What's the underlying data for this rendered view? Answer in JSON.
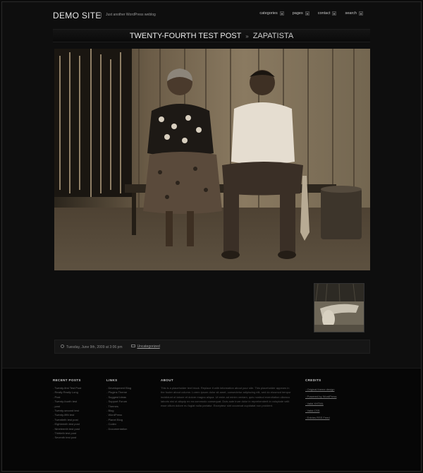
{
  "header": {
    "site_title": "DEMO SITE",
    "tagline": "Just another WordPress weblog",
    "nav": [
      {
        "label": "categories"
      },
      {
        "label": "pages"
      },
      {
        "label": "contact"
      },
      {
        "label": "search"
      }
    ]
  },
  "post": {
    "title": "TWENTY-FOURTH TEST POST",
    "separator": "»",
    "category": "ZAPATISTA",
    "date": "Tuesday, June 9th, 2009 at 3:06 pm",
    "category_link": "Uncategorized"
  },
  "footer": {
    "recent_posts": {
      "heading": "RECENT POSTS",
      "items": [
        "Twenty-first Test Post",
        "Really Really Long",
        "Post",
        "Twenty-fourth test",
        "post",
        "Twenty-second test",
        "Twenty-fifth test",
        "Twentieth test post",
        "Eighteenth test post",
        "Nineteenth test post",
        "Thirtieth test post",
        "Seventh test post"
      ]
    },
    "links": {
      "heading": "LINKS",
      "items": [
        "Development Blog",
        "Plugins Theme",
        "Suggest Ideas",
        "Support Forum",
        "Themes",
        "Blog",
        "WordPress",
        "Planet Blog",
        "Codex",
        "Documentation"
      ]
    },
    "about": {
      "heading": "ABOUT",
      "text": "This is a placeholder text block. Replace it with information about your site. This placeholder appears in the footer about column. Lorem ipsum dolor sit amet, consectetur adipiscing elit, sed do eiusmod tempor incididunt ut labore et dolore magna aliqua. Ut enim ad minim veniam, quis nostrud exercitation ullamco laboris nisi ut aliquip ex ea commodo consequat. Duis aute irure dolor in reprehenderit in voluptate velit esse cillum dolore eu fugiat nulla pariatur. Excepteur sint occaecat cupidatat non proident."
    },
    "credits": {
      "heading": "CREDITS",
      "items": [
        "Original theme design",
        "Powered by WordPress",
        "Valid XHTML",
        "Valid CSS",
        "Entries RSS Feed"
      ]
    }
  },
  "colors": {
    "background": "#0c0c0c",
    "footer_background": "#060606",
    "title_text": "#ececec"
  }
}
